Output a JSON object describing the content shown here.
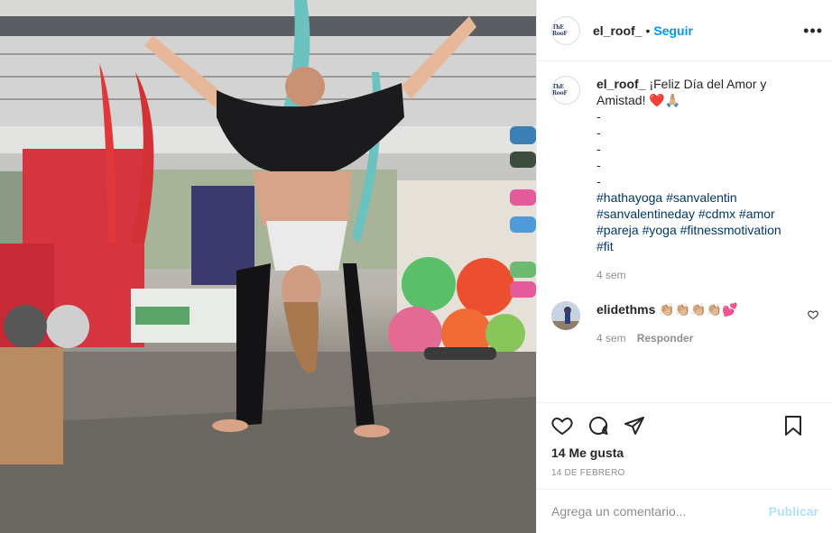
{
  "post": {
    "photo_alt": "Acro yoga pose in aerial studio",
    "author": "el_roof_",
    "avatar_text": "ThE RooF",
    "dot": "•",
    "follow_label": "Seguir",
    "more_label": "•••"
  },
  "caption": {
    "user": "el_roof_",
    "text_line": "¡Feliz Día del Amor y Amistad! ❤️🙏🏼",
    "dashes": [
      "-",
      "-",
      "-",
      "-",
      "-"
    ],
    "hashtags": [
      "#hathayoga",
      "#sanvalentin",
      "#sanvalentineday",
      "#cdmx",
      "#amor",
      "#pareja",
      "#yoga",
      "#fitnessmotivation",
      "#fit"
    ],
    "time": "4 sem"
  },
  "comment": {
    "user": "elidethms",
    "text": "👏🏼👏🏼👏🏼👏🏼💕",
    "time": "4 sem",
    "reply_label": "Responder"
  },
  "actions": {
    "likes": "14 Me gusta",
    "date": "14 DE FEBRERO"
  },
  "composer": {
    "placeholder": "Agrega un comentario...",
    "post_label": "Publicar"
  },
  "colors": {
    "accent": "#0095f6",
    "hashtag": "#00376b",
    "muted": "#8e8e8e",
    "post_disabled": "#b2dffc"
  }
}
